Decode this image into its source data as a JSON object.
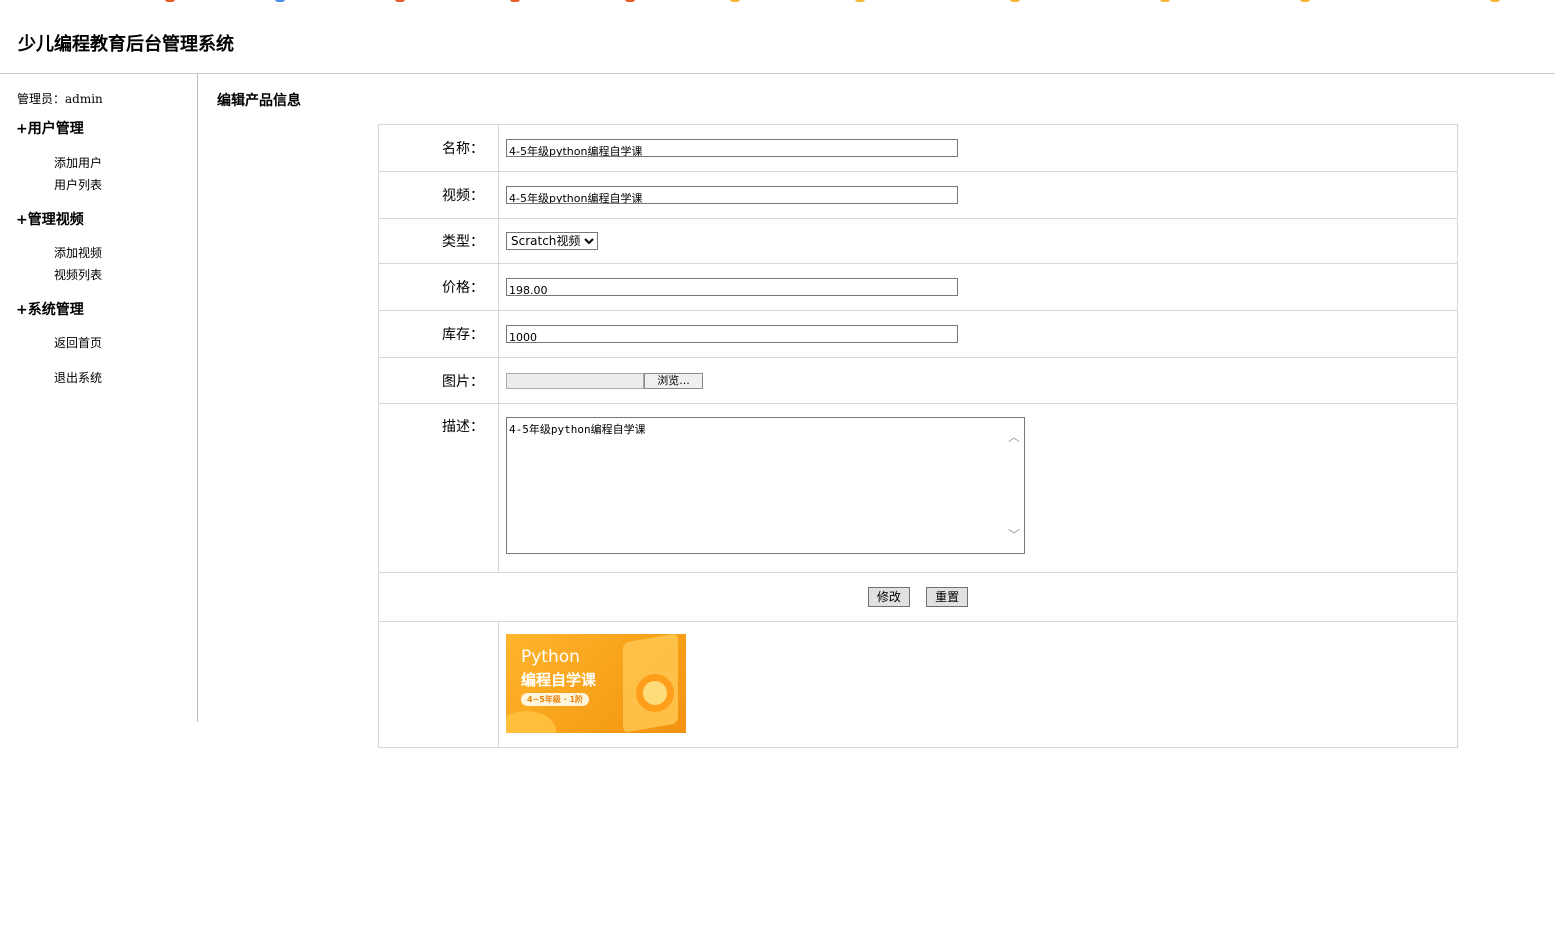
{
  "app": {
    "title": "少儿编程教育后台管理系统"
  },
  "sidebar": {
    "admin_label": "管理员：admin",
    "groups": [
      {
        "title": "+用户管理",
        "items": [
          "添加用户",
          "用户列表"
        ]
      },
      {
        "title": "+管理视频",
        "items": [
          "添加视频",
          "视频列表"
        ]
      },
      {
        "title": "+系统管理",
        "items": [
          "返回首页",
          "退出系统"
        ]
      }
    ]
  },
  "main": {
    "title": "编辑产品信息",
    "form": {
      "name": {
        "label": "名称：",
        "value": "4-5年级python编程自学课"
      },
      "video": {
        "label": "视频：",
        "value": "4-5年级python编程自学课"
      },
      "type": {
        "label": "类型：",
        "selected": "Scratch视频"
      },
      "price": {
        "label": "价格：",
        "value": "198.00"
      },
      "stock": {
        "label": "库存：",
        "value": "1000"
      },
      "image": {
        "label": "图片：",
        "browse_label": "浏览..."
      },
      "description": {
        "label": "描述：",
        "value": "4-5年级python编程自学课"
      }
    },
    "buttons": {
      "submit": "修改",
      "reset": "重置"
    },
    "preview": {
      "line1": "Python",
      "line2": "编程自学课",
      "badge": "4~5年级 · 1阶"
    }
  }
}
